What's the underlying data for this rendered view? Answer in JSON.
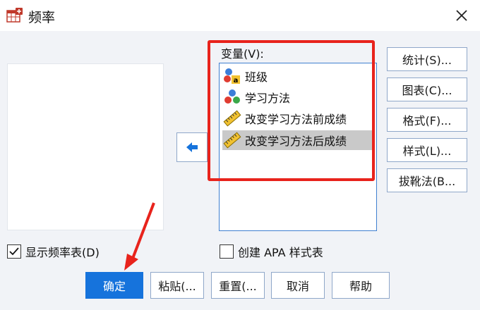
{
  "window": {
    "title": "频率",
    "icon": "spss-frequencies-icon",
    "close_icon": "close-icon"
  },
  "variables": {
    "label": "变量(V):",
    "items": [
      {
        "label": "班级",
        "icon": "nominal-variable-icon",
        "selected": false
      },
      {
        "label": "学习方法",
        "icon": "nominal-variable-icon",
        "selected": false
      },
      {
        "label": "改变学习方法前成绩",
        "icon": "scale-variable-icon",
        "selected": false
      },
      {
        "label": "改变学习方法后成绩",
        "icon": "scale-variable-icon",
        "selected": true
      }
    ]
  },
  "move_button": {
    "icon": "arrow-left-icon"
  },
  "side_buttons": {
    "statistics": "统计(S)...",
    "charts": "图表(C)...",
    "format": "格式(F)...",
    "style": "样式(L)...",
    "bootstrap": "拔靴法(B..."
  },
  "options": {
    "show_frequency_table": {
      "label": "显示频率表(D)",
      "checked": true
    },
    "create_apa_table": {
      "label": "创建 APA 样式表",
      "checked": false
    }
  },
  "bottom_buttons": {
    "ok": "确定",
    "paste": "粘贴(...",
    "reset": "重置(...",
    "cancel": "取消",
    "help": "帮助"
  },
  "colors": {
    "primary": "#1673dc",
    "annotation_red": "#e8231c",
    "selected_row": "#c9c9c9"
  }
}
